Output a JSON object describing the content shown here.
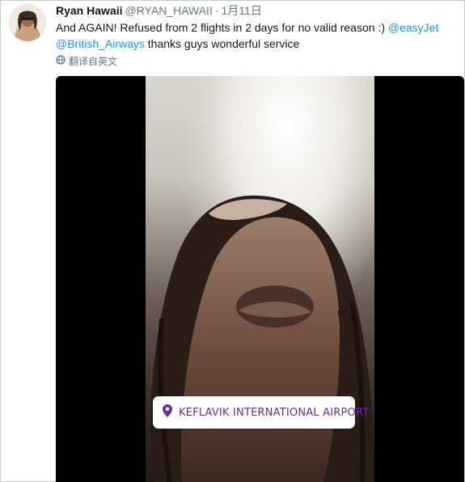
{
  "tweet": {
    "display_name": "Ryan Hawaii",
    "handle": "@RYAN_HAWAII",
    "separator": "·",
    "date": "1月11日",
    "text_intro": "And AGAIN! Refused from 2 flights in 2 days for no valid reason :) ",
    "mention_1": "@easyJet",
    "mention_2": "@British_Airways",
    "text_outro": " thanks guys wonderful service",
    "translate_label": "翻译自英文"
  },
  "media": {
    "location_sticker": "KEFLAVIK INTERNATIONAL AIRPORT"
  },
  "colors": {
    "link": "#1b95e0",
    "muted": "#657786",
    "sticker_text": "#6b2aa6"
  },
  "icons": {
    "translate": "globe-icon",
    "location": "location-pin-icon"
  }
}
